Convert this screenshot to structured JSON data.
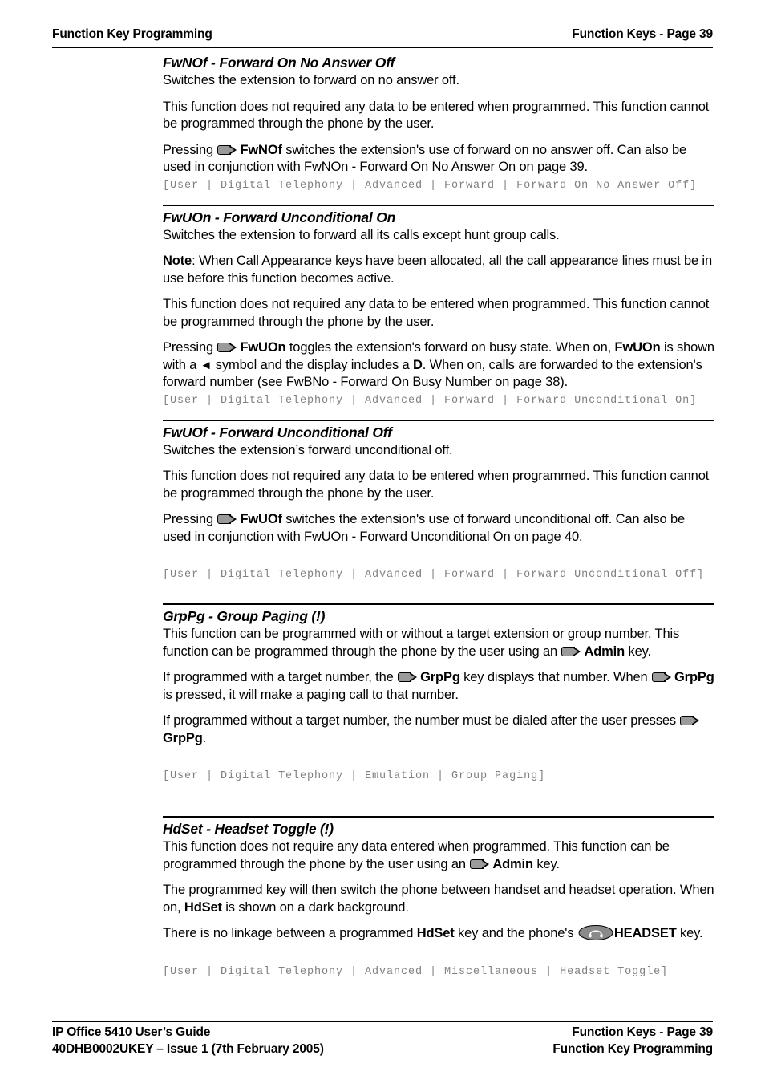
{
  "header": {
    "left": "Function Key Programming",
    "right": "Function Keys - Page 39"
  },
  "footer": {
    "left_line1": "IP Office 5410 User’s Guide",
    "left_line2": "40DHB0002UKEY – Issue 1 (7th February 2005)",
    "right_line1": "Function Keys - Page 39",
    "right_line2": "Function Key Programming"
  },
  "icons": {
    "programmable_key": "programmable-key-icon",
    "headset": "headset-icon",
    "left_triangle": "◄"
  },
  "sections": {
    "fwnof": {
      "title": "FwNOf - Forward On No Answer Off",
      "p1": "Switches the extension to forward on no answer off.",
      "p2": "This function does not required any data to be entered when programmed. This function cannot be programmed through the phone by the user.",
      "p3_pre": "Pressing ",
      "p3_key": "FwNOf",
      "p3_post": " switches the extension's use of forward on no answer off. Can also be used in conjunction with FwNOn - Forward On No Answer On on page 39.",
      "path": "[User | Digital Telephony | Advanced | Forward | Forward On No Answer Off]"
    },
    "fwuon": {
      "title": "FwUOn - Forward Unconditional On",
      "p1": "Switches the extension to forward all its calls except hunt group calls.",
      "p2_label": "Note",
      "p2_text": ": When Call Appearance keys have been allocated, all the call appearance lines must be in use before this function becomes active.",
      "p3": "This function does not required any data to be entered when programmed. This function cannot be programmed through the phone by the user.",
      "p4_pre": "Pressing ",
      "p4_key": "FwUOn",
      "p4_mid1": " toggles the extension's forward on busy state. When on, ",
      "p4_key2": "FwUOn",
      "p4_mid2": " is shown with a ",
      "p4_sym": "◄",
      "p4_mid3": " symbol and the display includes a ",
      "p4_key3": "D",
      "p4_post": ". When on, calls are forwarded to the extension's forward number (see FwBNo - Forward On Busy Number on page 38).",
      "path": "[User | Digital Telephony | Advanced | Forward | Forward Unconditional On]"
    },
    "fwuof": {
      "title": "FwUOf - Forward Unconditional Off",
      "p1": "Switches the extension’s forward unconditional off.",
      "p2": "This function does not required any data to be entered when programmed. This function cannot be programmed through the phone by the user.",
      "p3_pre": "Pressing ",
      "p3_key": "FwUOf",
      "p3_post": " switches the extension's use of forward unconditional off. Can also be used in conjunction with FwUOn - Forward Unconditional On on page 40.",
      "path": "[User | Digital Telephony | Advanced | Forward | Forward Unconditional Off]"
    },
    "grppg": {
      "title": "GrpPg - Group Paging (!)",
      "p1_a": "This function can be programmed with or without a target extension or group number. This function can be programmed through the phone by the user using an ",
      "p1_key": "Admin",
      "p1_b": " key.",
      "p2_a": "If programmed with a target number, the ",
      "p2_key": "GrpPg",
      "p2_b": " key displays that number. When ",
      "p2_key2": "GrpPg",
      "p2_c": " is pressed, it will make a paging call to that number.",
      "p3_a": "If programmed without a target number, the number must be dialed after the user presses ",
      "p3_key": "GrpPg",
      "p3_b": ".",
      "path": "[User | Digital Telephony | Emulation | Group Paging]"
    },
    "hdset": {
      "title": "HdSet - Headset Toggle (!)",
      "p1_a": "This function does not require any data entered when programmed. This function can be programmed through the phone by the user using an ",
      "p1_key": "Admin",
      "p1_b": " key.",
      "p2_a": "The programmed key will then switch the phone between handset and headset operation. When on, ",
      "p2_key": "HdSet",
      "p2_b": " is shown on a dark background.",
      "p3_a": "There is no linkage between a programmed ",
      "p3_key": "HdSet",
      "p3_b": " key and the phone's ",
      "p3_key2": "HEADSET",
      "p3_c": " key.",
      "path": "[User | Digital Telephony | Advanced | Miscellaneous | Headset Toggle]"
    }
  },
  "colors": {
    "text": "#000000",
    "path_text": "#808080",
    "key_fill": "#9a9a9a",
    "rule": "#000000"
  }
}
